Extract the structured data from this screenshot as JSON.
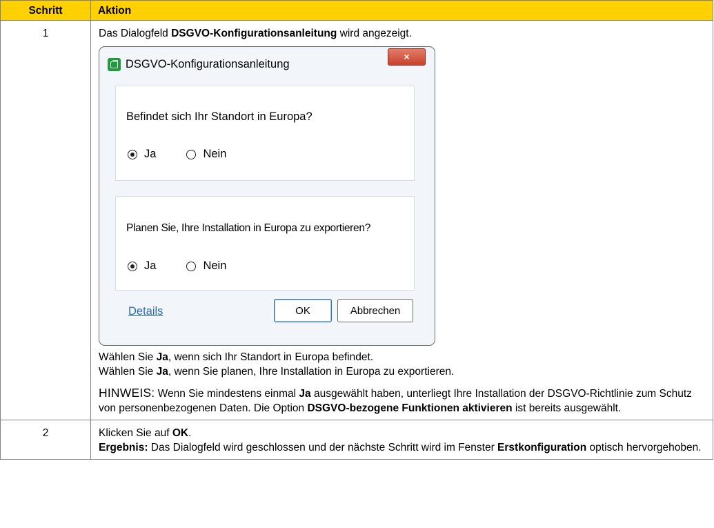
{
  "table": {
    "headers": [
      "Schritt",
      "Aktion"
    ],
    "header_color": "#ffd100"
  },
  "step1": {
    "number": "1",
    "intro_pre": "Das Dialogfeld ",
    "intro_bold": "DSGVO-Konfigurationsanleitung",
    "intro_post": " wird angezeigt.",
    "dialog": {
      "title": "DSGVO-Konfigurationsanleitung",
      "close_glyph": "×",
      "question1": "Befindet sich Ihr Standort in Europa?",
      "q1_options": [
        {
          "label": "Ja",
          "selected": true
        },
        {
          "label": "Nein",
          "selected": false
        }
      ],
      "question2": "Planen Sie, Ihre Installation in Europa zu exportieren?",
      "q2_options": [
        {
          "label": "Ja",
          "selected": true
        },
        {
          "label": "Nein",
          "selected": false
        }
      ],
      "details_link": "Details",
      "ok_label": "OK",
      "cancel_label": "Abbrechen"
    },
    "line1_pre": "Wählen Sie ",
    "line1_bold": "Ja",
    "line1_post": ", wenn sich Ihr Standort in Europa befindet.",
    "line2_pre": "Wählen Sie ",
    "line2_bold": "Ja",
    "line2_post": ", wenn Sie planen, Ihre Installation in Europa zu exportieren.",
    "note_label": "HINWEIS:",
    "note_a": " Wenn Sie mindestens einmal ",
    "note_bold1": "Ja",
    "note_b": " ausgewählt haben, unterliegt Ihre Installation der DSGVO-Richtlinie zum Schutz von personenbezogenen Daten. Die Option ",
    "note_bold2": "DSGVO-bezogene Funktionen aktivieren",
    "note_c": " ist bereits ausgewählt."
  },
  "step2": {
    "number": "2",
    "line1_pre": "Klicken Sie auf ",
    "line1_bold": "OK",
    "line1_post": ".",
    "result_label": "Ergebnis:",
    "result_text": " Das Dialogfeld wird geschlossen und der nächste Schritt wird im Fenster ",
    "result_bold": "Erstkonfiguration",
    "result_post": " optisch hervorgehoben."
  }
}
